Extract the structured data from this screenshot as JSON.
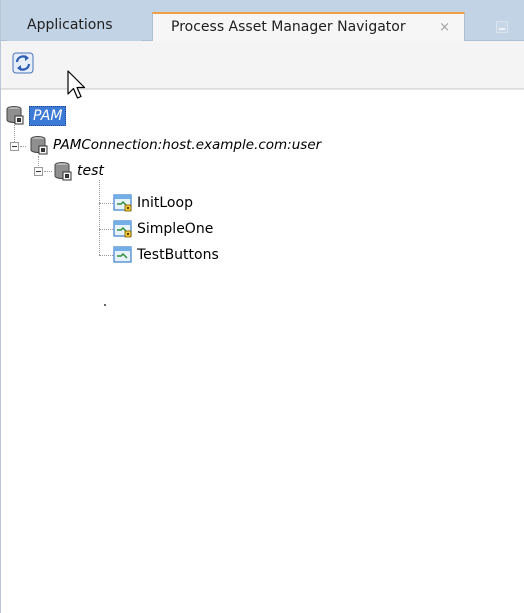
{
  "tabs": {
    "applications": "Applications",
    "pam_navigator": "Process Asset Manager Navigator",
    "close_glyph": "×"
  },
  "toolbar": {
    "refresh_icon": "refresh-icon"
  },
  "tree": {
    "root": {
      "label": "PAM",
      "icon": "database-icon",
      "selected": true
    },
    "connection": {
      "label": "PAMConnection:host.example.com:user",
      "icon": "database-icon"
    },
    "folder": {
      "label": "test",
      "icon": "database-icon"
    },
    "items": [
      {
        "label": "InitLoop",
        "icon": "process-locked-icon"
      },
      {
        "label": "SimpleOne",
        "icon": "process-locked-icon"
      },
      {
        "label": "TestButtons",
        "icon": "process-icon"
      }
    ]
  },
  "colors": {
    "tabbar": "#c2d3e6",
    "active_tab_accent": "#f0a044",
    "selection": "#3d7ad6"
  }
}
